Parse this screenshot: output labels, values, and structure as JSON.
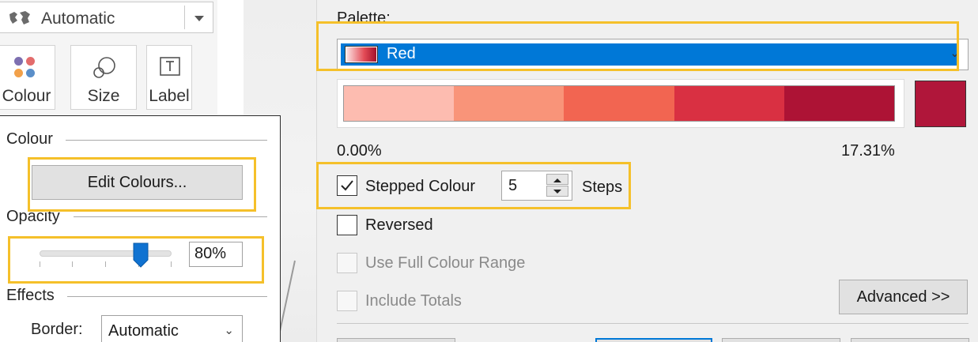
{
  "marks": {
    "mark_type": "Automatic",
    "cards": {
      "colour": "Colour",
      "size": "Size",
      "label": "Label"
    }
  },
  "colour_popup": {
    "colour_section": "Colour",
    "edit_colours_button": "Edit Colours...",
    "opacity_section": "Opacity",
    "opacity_value": "80%",
    "opacity_fraction": 0.8,
    "effects_section": "Effects",
    "border_label": "Border:",
    "border_value": "Automatic"
  },
  "edit_colours": {
    "palette_label": "Palette:",
    "palette_value": "Red",
    "range_min": "0.00%",
    "range_max": "17.31%",
    "steps_colors": [
      "#fdbcb0",
      "#f99479",
      "#f26551",
      "#d93042",
      "#ad1335"
    ],
    "end_color": "#b0163a",
    "stepped_colour": {
      "label": "Stepped Colour",
      "checked": true,
      "steps_value": "5",
      "steps_label": "Steps"
    },
    "reversed": {
      "label": "Reversed",
      "checked": false
    },
    "use_full_colour_range": {
      "label": "Use Full Colour Range",
      "checked": false,
      "enabled": false
    },
    "include_totals": {
      "label": "Include Totals",
      "checked": false,
      "enabled": false
    },
    "advanced_button": "Advanced >>"
  },
  "theme": {
    "highlight": "#f5c02a",
    "selection": "#0078d7"
  }
}
